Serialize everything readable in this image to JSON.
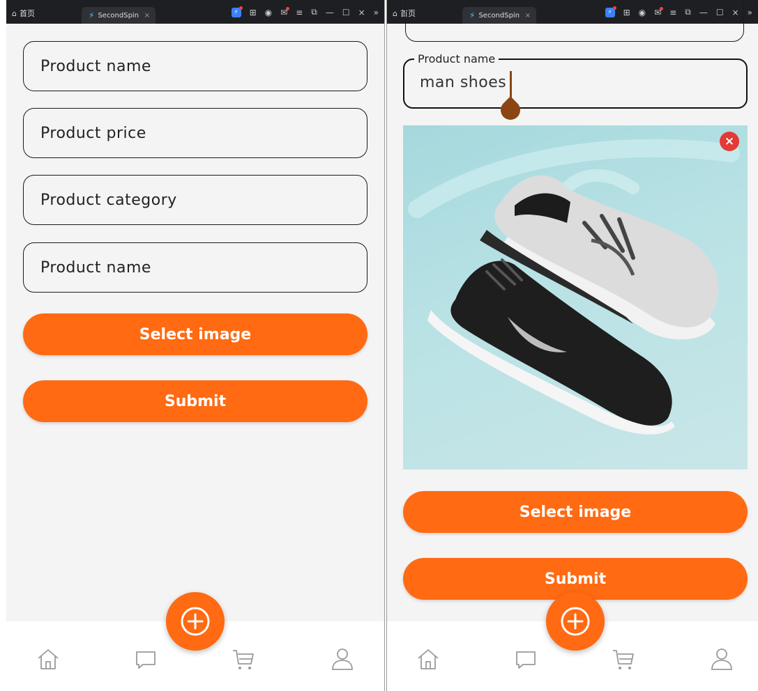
{
  "titlebar": {
    "home_tab": "首页",
    "app_tab": "SecondSpin",
    "close": "×",
    "overflow": "»"
  },
  "left": {
    "fields": [
      {
        "placeholder": "Product name"
      },
      {
        "placeholder": "Product price"
      },
      {
        "placeholder": "Product category"
      },
      {
        "placeholder": "Product name"
      }
    ],
    "select_image_label": "Select image",
    "submit_label": "Submit"
  },
  "right": {
    "product_name_label": "Product name",
    "product_name_value": "man shoes",
    "remove_image": "×",
    "select_image_label": "Select image",
    "submit_label": "Submit"
  },
  "nav": {
    "items": [
      "home-icon",
      "chat-icon",
      "cart-icon",
      "profile-icon"
    ],
    "fab_icon": "add-circle-icon"
  },
  "colors": {
    "accent": "#ff6a12",
    "caret": "#8b4513",
    "remove": "#e53935",
    "background": "#f4f4f4"
  }
}
